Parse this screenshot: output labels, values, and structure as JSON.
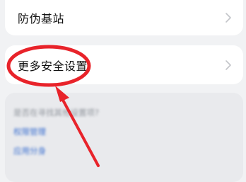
{
  "settings": {
    "anti_fake_base_station": "防伪基站",
    "more_security_settings": "更多安全设置"
  },
  "suggestions": {
    "question": "是否在寻找其他设置项?",
    "links": [
      "权限管理",
      "应用分身"
    ]
  },
  "colors": {
    "annotation": "#e8232a",
    "link": "#3a6fd0",
    "background": "#f1f2f4"
  }
}
